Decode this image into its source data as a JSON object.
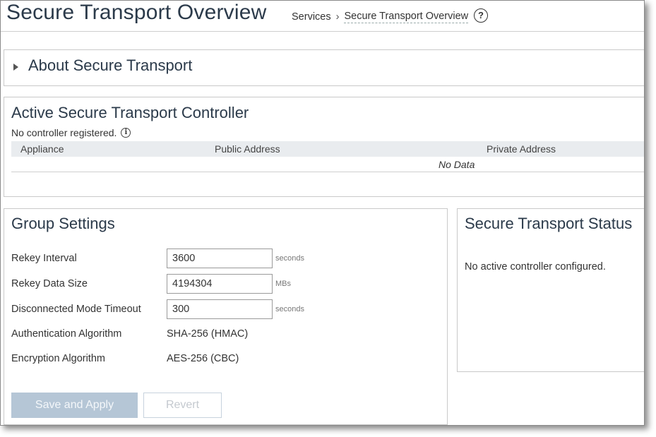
{
  "header": {
    "title": "Secure Transport Overview",
    "breadcrumb": [
      "Services",
      "Secure Transport Overview"
    ],
    "help_glyph": "?"
  },
  "about_section": {
    "title": "About Secure Transport",
    "expanded": false
  },
  "active_controller": {
    "title": "Active Secure Transport Controller",
    "note": "No controller registered.",
    "info_glyph": "i",
    "columns": [
      "Appliance",
      "Public Address",
      "Private Address"
    ],
    "empty_text": "No Data"
  },
  "group_settings": {
    "title": "Group Settings",
    "fields": [
      {
        "label": "Rekey Interval",
        "value": "3600",
        "unit": "seconds"
      },
      {
        "label": "Rekey Data Size",
        "value": "4194304",
        "unit": "MBs"
      },
      {
        "label": "Disconnected Mode Timeout",
        "value": "300",
        "unit": "seconds"
      }
    ],
    "readonly": [
      {
        "label": "Authentication Algorithm",
        "value": "SHA-256 (HMAC)"
      },
      {
        "label": "Encryption Algorithm",
        "value": "AES-256 (CBC)"
      }
    ],
    "save_label": "Save and Apply",
    "revert_label": "Revert"
  },
  "status_panel": {
    "title": "Secure Transport Status",
    "message": "No active controller configured."
  },
  "colors": {
    "title_text": "#2b3a4a",
    "save_button_disabled": "#b5c6d6",
    "table_header_bg": "#e9ecef"
  },
  "icons": [
    "help-icon",
    "expand-triangle-icon",
    "info-icon"
  ]
}
